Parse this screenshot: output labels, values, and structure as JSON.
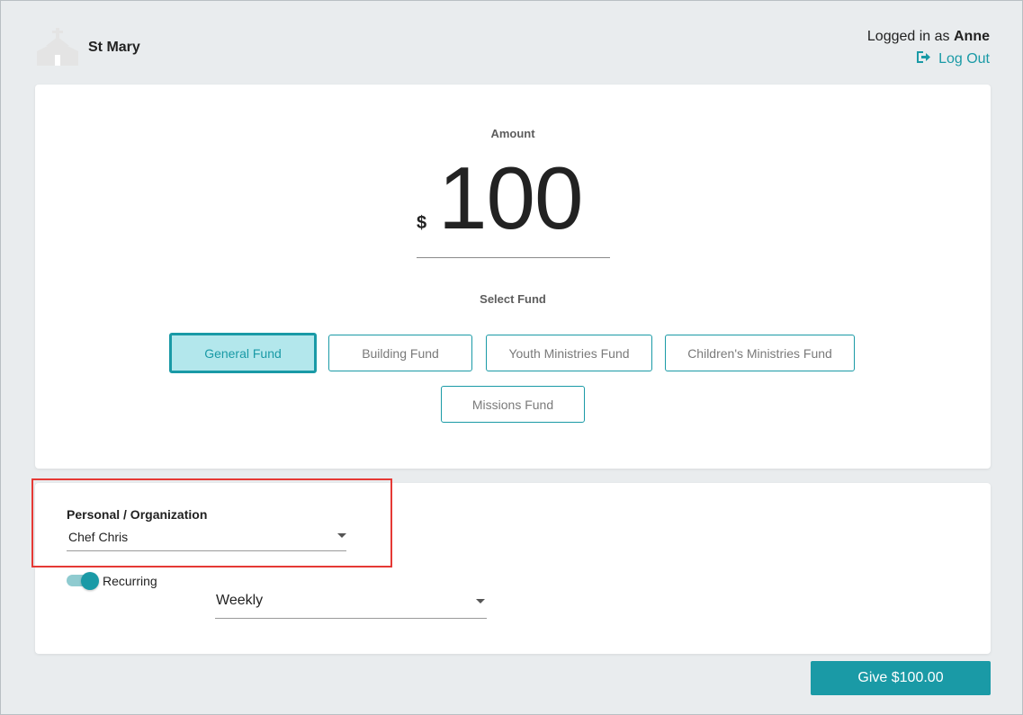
{
  "header": {
    "church_name": "St Mary",
    "logged_in_prefix": "Logged in as",
    "user_name": "Anne",
    "logout_label": "Log Out",
    "logo_icon": "church-icon",
    "logout_icon": "sign-out-icon"
  },
  "amount": {
    "label": "Amount",
    "currency_symbol": "$",
    "value": "100"
  },
  "funds": {
    "label": "Select Fund",
    "items": [
      {
        "label": "General Fund",
        "selected": true
      },
      {
        "label": "Building Fund",
        "selected": false
      },
      {
        "label": "Youth Ministries Fund",
        "selected": false
      },
      {
        "label": "Children's Ministries Fund",
        "selected": false
      },
      {
        "label": "Missions Fund",
        "selected": false
      }
    ]
  },
  "giver": {
    "label": "Personal / Organization",
    "selected": "Chef Chris"
  },
  "recurring": {
    "label": "Recurring",
    "enabled": true,
    "frequency": "Weekly"
  },
  "submit": {
    "label": "Give $100.00"
  },
  "colors": {
    "accent": "#1a9aa6",
    "selected_bg": "#b3e7ec",
    "highlight": "#e53935",
    "background": "#e9ecee"
  }
}
